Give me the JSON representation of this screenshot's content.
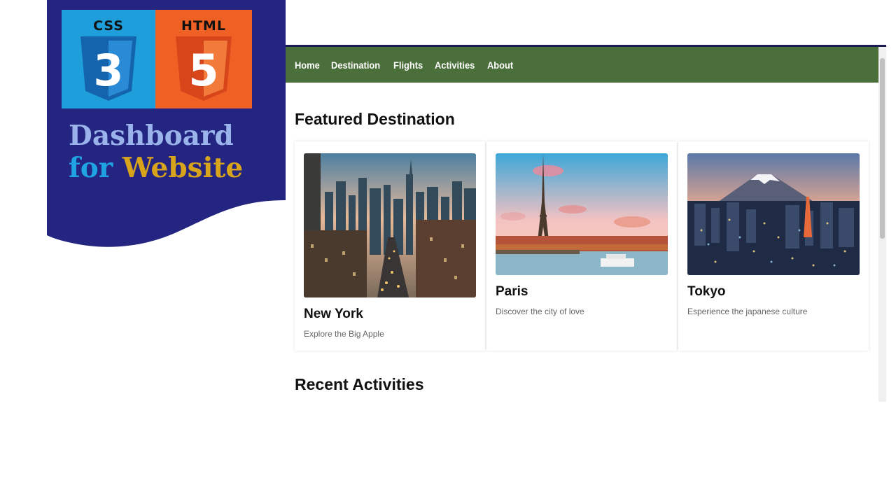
{
  "banner": {
    "css_logo_label": "CSS",
    "css_logo_number": "3",
    "html_logo_label": "HTML",
    "html_logo_number": "5",
    "headline_line1": "Dashboard",
    "headline_line2_a": "for ",
    "headline_line2_b": "Website"
  },
  "nav": {
    "items": [
      "Home",
      "Destination",
      "Flights",
      "Activities",
      "About"
    ]
  },
  "featured": {
    "title": "Featured Destination",
    "cards": [
      {
        "title": "New York",
        "description": "Explore the Big Apple"
      },
      {
        "title": "Paris",
        "description": "Discover the city of love"
      },
      {
        "title": "Tokyo",
        "description": "Esperience the japanese culture"
      }
    ]
  },
  "recent": {
    "title": "Recent Activities"
  },
  "colors": {
    "navbar": "#4a6f3a",
    "banner": "#232580",
    "css_logo": "#1e9fdc",
    "html_logo": "#ef6024",
    "accent_gold": "#d8a41c"
  }
}
